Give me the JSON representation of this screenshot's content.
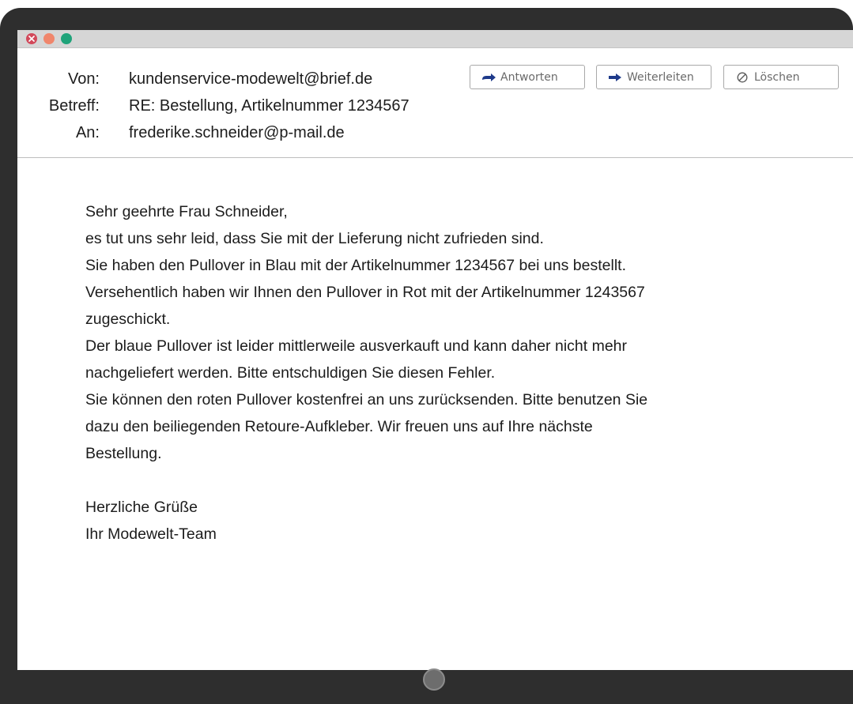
{
  "header": {
    "from_label": "Von:",
    "from_value": "kundenservice-modewelt@brief.de",
    "subject_label": "Betreff:",
    "subject_value": "RE: Bestellung, Artikelnummer 1234567",
    "to_label": "An:",
    "to_value": "frederike.schneider@p-mail.de"
  },
  "toolbar": {
    "reply_label": "Antworten",
    "forward_label": "Weiterleiten",
    "delete_label": "Löschen"
  },
  "message": {
    "greeting": "Sehr geehrte Frau Schneider,",
    "lines": [
      "es tut uns sehr leid, dass Sie mit der Lieferung nicht zufrieden sind.",
      "Sie haben den Pullover in Blau mit der Artikelnummer 1234567 bei uns bestellt.",
      "Versehentlich haben wir Ihnen den Pullover in Rot mit der Artikelnummer 1243567",
      "zugeschickt.",
      "Der blaue Pullover ist leider mittlerweile ausverkauft und kann daher nicht mehr",
      "nachgeliefert werden. Bitte entschuldigen Sie diesen Fehler.",
      "Sie können den roten Pullover kostenfrei an uns zurücksenden. Bitte benutzen Sie",
      "dazu den beiliegenden Retoure-Aufkleber. Wir freuen uns auf Ihre nächste",
      "Bestellung."
    ],
    "closing": "Herzliche Grüße",
    "signature": "Ihr Modewelt-Team"
  },
  "colors": {
    "close": "#d2485a",
    "minimize": "#f0866c",
    "maximize": "#20a37a",
    "frame": "#2e2e2e"
  },
  "icons": {
    "reply": "reply-arrow-icon",
    "forward": "forward-arrow-icon",
    "delete": "prohibit-icon"
  }
}
